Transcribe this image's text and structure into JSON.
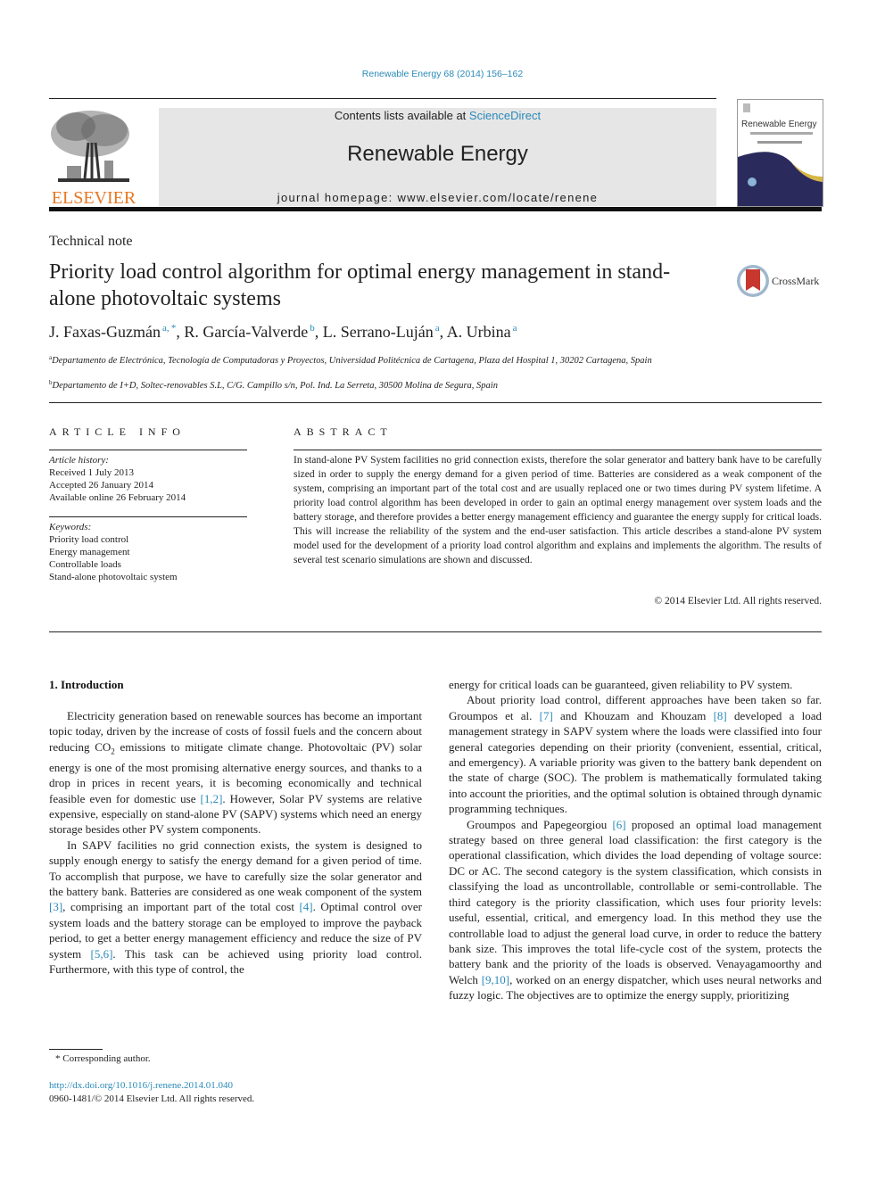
{
  "header": {
    "journal_reference": "Renewable Energy 68 (2014) 156–162",
    "contents_prefix": "Contents lists available at ",
    "contents_link": "ScienceDirect",
    "journal_title": "Renewable Energy",
    "homepage": "journal homepage: www.elsevier.com/locate/renene",
    "publisher_logo_text": "ELSEVIER",
    "cover_title": "Renewable Energy",
    "crossmark_label": "CrossMark"
  },
  "article": {
    "type": "Technical note",
    "title": "Priority load control algorithm for optimal energy management in stand-alone photovoltaic systems",
    "authors": [
      {
        "name": "J. Faxas-Guzmán",
        "sup": "a, *"
      },
      {
        "name": "R. García-Valverde",
        "sup": "b"
      },
      {
        "name": "L. Serrano-Luján",
        "sup": "a"
      },
      {
        "name": "A. Urbina",
        "sup": "a"
      }
    ],
    "affiliations": [
      {
        "mark": "a",
        "text": "Departamento de Electrónica, Tecnología de Computadoras y Proyectos, Universidad Politécnica de Cartagena, Plaza del Hospital 1, 30202 Cartagena, Spain"
      },
      {
        "mark": "b",
        "text": "Departamento de I+D, Soltec-renovables S.L, C/G. Campillo s/n, Pol. Ind. La Serreta, 30500 Molina de Segura, Spain"
      }
    ]
  },
  "article_info": {
    "heading": "ARTICLE INFO",
    "history_label": "Article history:",
    "history": [
      "Received 1 July 2013",
      "Accepted 26 January 2014",
      "Available online 26 February 2014"
    ],
    "keywords_label": "Keywords:",
    "keywords": [
      "Priority load control",
      "Energy management",
      "Controllable loads",
      "Stand-alone photovoltaic system"
    ]
  },
  "abstract": {
    "heading": "ABSTRACT",
    "text": "In stand-alone PV System facilities no grid connection exists, therefore the solar generator and battery bank have to be carefully sized in order to supply the energy demand for a given period of time. Batteries are considered as a weak component of the system, comprising an important part of the total cost and are usually replaced one or two times during PV system lifetime. A priority load control algorithm has been developed in order to gain an optimal energy management over system loads and the battery storage, and therefore provides a better energy management efficiency and guarantee the energy supply for critical loads. This will increase the reliability of the system and the end-user satisfaction. This article describes a stand-alone PV system model used for the development of a priority load control algorithm and explains and implements the algorithm. The results of several test scenario simulations are shown and discussed.",
    "copyright": "© 2014 Elsevier Ltd. All rights reserved."
  },
  "body": {
    "section_heading": "1.  Introduction",
    "left": {
      "p1": {
        "a": "Electricity generation based on renewable sources has become an important topic today, driven by the increase of costs of fossil fuels and the concern about reducing CO",
        "sub": "2",
        "b": " emissions to mitigate climate change. Photovoltaic (PV) solar energy is one of the most promising alternative energy sources, and thanks to a drop in prices in recent years, it is becoming economically and technical feasible even for domestic use ",
        "ref1": "[1,2]",
        "c": ". However, Solar PV systems are relative expensive, especially on stand-alone PV (SAPV) systems which need an energy storage besides other PV system components."
      },
      "p2": {
        "a": "In SAPV facilities no grid connection exists, the system is designed to supply enough energy to satisfy the energy demand for a given period of time. To accomplish that purpose, we have to carefully size the solar generator and the battery bank. Batteries are considered as one weak component of the system ",
        "ref1": "[3]",
        "b": ", comprising an important part of the total cost ",
        "ref2": "[4]",
        "c": ". Optimal control over system loads and the battery storage can be employed to improve the payback period, to get a better energy management efficiency and reduce the size of PV system ",
        "ref3": "[5,6]",
        "d": ". This task can be achieved using priority load control. Furthermore, with this type of control, the"
      }
    },
    "right": {
      "p0": "energy for critical loads can be guaranteed, given reliability to PV system.",
      "p1": {
        "a": "About priority load control, different approaches have been taken so far. Groumpos et al. ",
        "ref1": "[7]",
        "b": " and Khouzam and Khouzam ",
        "ref2": "[8]",
        "c": " developed a load management strategy in SAPV system where the loads were classified into four general categories depending on their priority (convenient, essential, critical, and emergency). A variable priority was given to the battery bank dependent on the state of charge (SOC). The problem is mathematically formulated taking into account the priorities, and the optimal solution is obtained through dynamic programming techniques."
      },
      "p2": {
        "a": "Groumpos and Papegeorgiou ",
        "ref1": "[6]",
        "b": " proposed an optimal load management strategy based on three general load classification: the first category is the operational classification, which divides the load depending of voltage source: DC or AC. The second category is the system classification, which consists in classifying the load as uncontrollable, controllable or semi-controllable. The third category is the priority classification, which uses four priority levels: useful, essential, critical, and emergency load. In this method they use the controllable load to adjust the general load curve, in order to reduce the battery bank size. This improves the total life-cycle cost of the system, protects the battery bank and the priority of the loads is observed. Venayagamoorthy and Welch ",
        "ref2": "[9,10]",
        "c": ", worked on an energy dispatcher, which uses neural networks and fuzzy logic. The objectives are to optimize the energy supply, prioritizing"
      }
    }
  },
  "footer": {
    "footnote": "* Corresponding author.",
    "doi": "http://dx.doi.org/10.1016/j.renene.2014.01.040",
    "issn": "0960-1481/© 2014 Elsevier Ltd. All rights reserved."
  },
  "colors": {
    "link": "#2a8ab8",
    "elsevier_orange": "#e87722",
    "banner_gray": "#e6e6e6"
  }
}
